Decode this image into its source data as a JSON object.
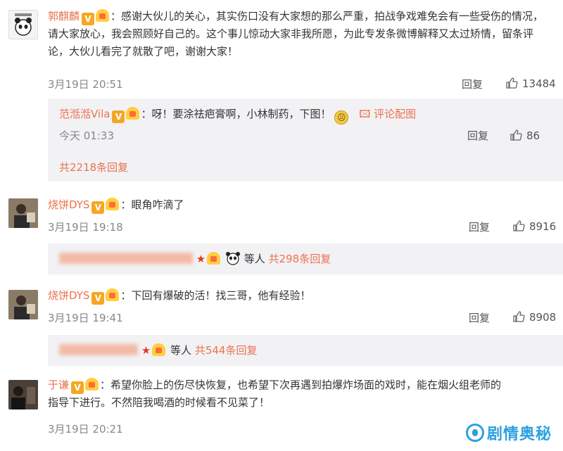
{
  "comments": [
    {
      "username": "郭麒麟",
      "v_badge": "V",
      "sep": "：",
      "text": "感谢大伙儿的关心，其实伤口没有大家想的那么严重，拍战争戏难免会有一些受伤的情况，请大家放心，我会照顾好自己的。这个事儿惊动大家非我所愿，为此专发条微博解释又太过矫情，留条评论，大伙儿看完了就散了吧，谢谢大家！",
      "time": "3月19日 20:51",
      "reply_label": "回复",
      "likes": "13484",
      "sub_reply": {
        "username": "范湉湉Vila",
        "v_badge": "V",
        "sep": "：",
        "text": "呀！要涂祛疤膏啊，小林制药，下图！",
        "pic_link": "评论配图",
        "time": "今天 01:33",
        "reply_label": "回复",
        "likes": "86"
      },
      "total_replies": "共2218条回复"
    },
    {
      "username": "烧饼DYS",
      "v_badge": "V",
      "sep": "：",
      "text": "眼角咋滴了",
      "time": "3月19日 19:18",
      "reply_label": "回复",
      "likes": "8916",
      "others_label": "等人",
      "total_replies": "共298条回复"
    },
    {
      "username": "烧饼DYS",
      "v_badge": "V",
      "sep": "：",
      "text": "下回有爆破的活！找三哥，他有经验！",
      "time": "3月19日 19:41",
      "reply_label": "回复",
      "likes": "8908",
      "others_label": "等人",
      "total_replies": "共544条回复"
    },
    {
      "username": "于谦",
      "v_badge": "V",
      "sep": "：",
      "text_line1": "希望你脸上的伤尽快恢复，也希望下次再遇到拍爆炸场面的戏时，能在烟火组老师的",
      "text_line2": "指导下进行。不然陪我喝酒的时候看不见菜了！",
      "time": "3月19日 20:21"
    }
  ],
  "watermark": {
    "text": "剧情奥秘"
  },
  "colors": {
    "username": "#eb7350",
    "badge": "#f5a623",
    "reply_box_bg": "#f2f2f5",
    "watermark": "#2ea0e0"
  }
}
